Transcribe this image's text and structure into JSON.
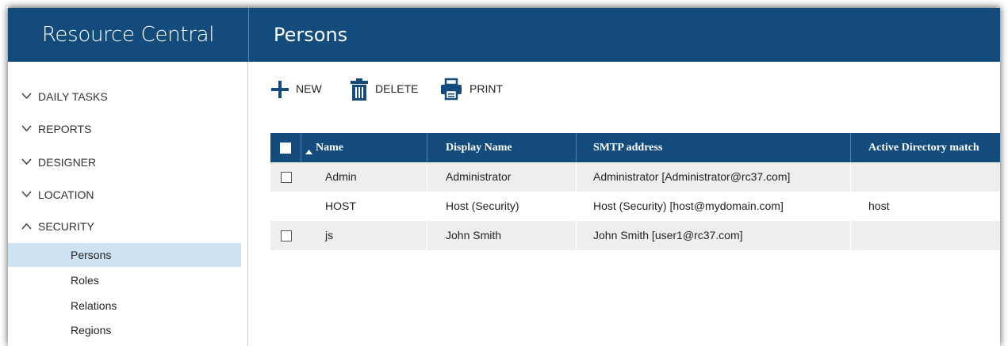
{
  "app": {
    "title": "Resource Central"
  },
  "page": {
    "title": "Persons"
  },
  "sidebar": {
    "sections": [
      {
        "label": "DAILY TASKS",
        "expanded": false
      },
      {
        "label": "REPORTS",
        "expanded": false
      },
      {
        "label": "DESIGNER",
        "expanded": false
      },
      {
        "label": "LOCATION",
        "expanded": false
      },
      {
        "label": "SECURITY",
        "expanded": true
      }
    ],
    "security_items": [
      {
        "label": "Persons",
        "active": true
      },
      {
        "label": "Roles",
        "active": false
      },
      {
        "label": "Relations",
        "active": false
      },
      {
        "label": "Regions",
        "active": false
      }
    ]
  },
  "toolbar": {
    "new_label": "NEW",
    "delete_label": "DELETE",
    "print_label": "PRINT"
  },
  "table": {
    "sort_indicator": "▲",
    "columns": [
      "Name",
      "Display Name",
      "SMTP address",
      "Active Directory match"
    ],
    "rows": [
      {
        "checkbox": true,
        "name": "Admin",
        "display_name": "Administrator",
        "smtp": "Administrator [Administrator@rc37.com]",
        "ad_match": ""
      },
      {
        "checkbox": false,
        "name": "HOST",
        "display_name": "Host (Security)",
        "smtp": "Host (Security) [host@mydomain.com]",
        "ad_match": "host"
      },
      {
        "checkbox": true,
        "name": "js",
        "display_name": "John Smith",
        "smtp": "John Smith [user1@rc37.com]",
        "ad_match": ""
      }
    ]
  },
  "colors": {
    "header_blue": "#134c7c",
    "active_nav": "#cfe2f4",
    "alt_row": "#eeeeee"
  },
  "icons": {
    "new": "plus-icon",
    "delete": "trash-icon",
    "print": "printer-icon",
    "collapsed": "chevron-down-icon",
    "expanded": "chevron-up-icon"
  }
}
